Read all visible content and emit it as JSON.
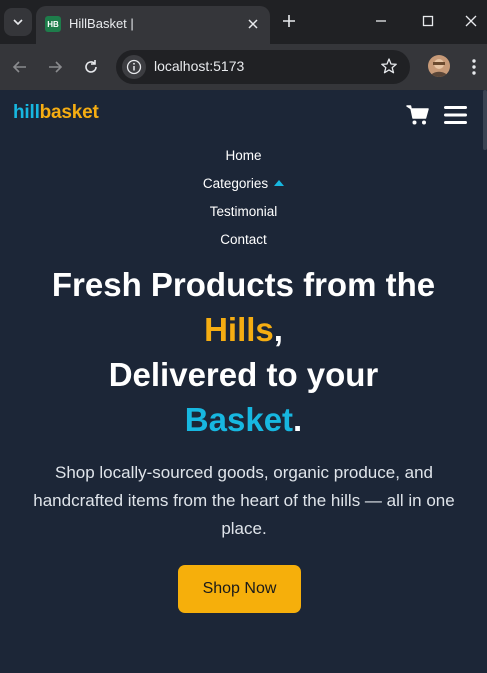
{
  "browser": {
    "tab_title": "HillBasket |",
    "favicon_text": "HB",
    "url": "localhost:5173"
  },
  "header": {
    "logo_part1": "hill",
    "logo_part2": "basket"
  },
  "nav": {
    "items": [
      {
        "label": "Home"
      },
      {
        "label": "Categories"
      },
      {
        "label": "Testimonial"
      },
      {
        "label": "Contact"
      }
    ]
  },
  "hero": {
    "line1": "Fresh Products from the",
    "line2_highlight": "Hills",
    "line2_rest": ",",
    "line3": "Delivered to your",
    "line4_highlight": "Basket",
    "line4_rest": ".",
    "subtitle": "Shop locally-sourced goods, organic produce, and handcrafted items from the heart of the hills — all in one place.",
    "cta_label": "Shop Now"
  },
  "colors": {
    "background": "#1c2637",
    "accent_yellow": "#f5ad12",
    "accent_cyan": "#17b7e0"
  }
}
